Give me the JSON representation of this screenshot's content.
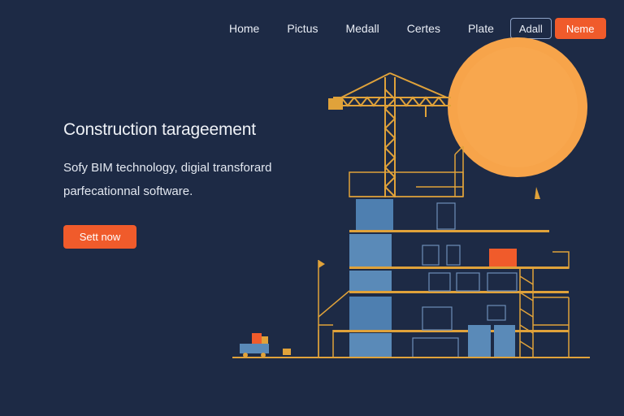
{
  "nav": {
    "links": [
      "Home",
      "Pictus",
      "Medall",
      "Certes",
      "Plate"
    ],
    "outline_button": "Adall",
    "primary_button": "Neme"
  },
  "hero": {
    "title": "Construction tarageement",
    "subtitle": "Sofy BIM technology, digial transforard parfecationnal software.",
    "cta_label": "Sett now"
  },
  "colors": {
    "background": "#1d2a45",
    "accent": "#f05b2b",
    "sun": "#f7a44a",
    "scaffold": "#e0a23a",
    "glass": "#5a8ab8"
  },
  "icons": [
    "crane-icon",
    "sun-icon",
    "building-icon",
    "truck-icon"
  ]
}
